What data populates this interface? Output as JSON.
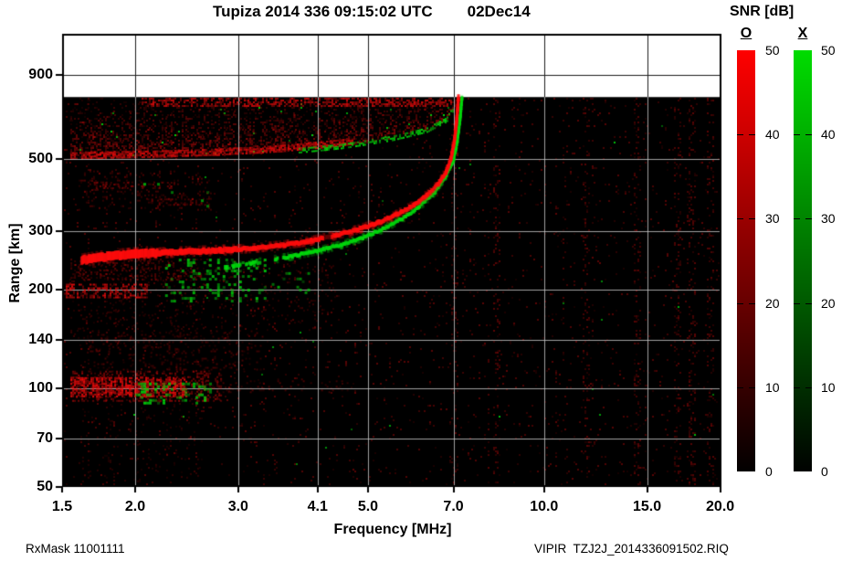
{
  "header": {
    "title": "Tupiza 2014 336 09:15:02 UTC",
    "date": "02Dec14"
  },
  "footer": {
    "rx_mask": "RxMask 11001111",
    "filename": "VIPIR  TZJ2J_2014336091502.RIQ"
  },
  "colorbar": {
    "title": "SNR [dB]",
    "range_db": [
      0,
      50
    ],
    "ticks": [
      {
        "label": "50",
        "value": 50
      },
      {
        "label": "40",
        "value": 40
      },
      {
        "label": "30",
        "value": 30
      },
      {
        "label": "20",
        "value": 20
      },
      {
        "label": "10",
        "value": 10
      },
      {
        "label": "0",
        "value": 0
      }
    ],
    "modes": [
      {
        "label": "O",
        "color": "#ff0000"
      },
      {
        "label": "X",
        "color": "#00dc00"
      }
    ]
  },
  "chart_data": {
    "type": "heatmap",
    "title": "Tupiza 2014 336 09:15:02 UTC 02Dec14",
    "xlabel": "Frequency [MHz]",
    "ylabel": "Range [km]",
    "x_scale": "log",
    "y_scale": "log",
    "xlim": [
      1.5,
      20.1
    ],
    "ylim": [
      50,
      1200
    ],
    "xticks": [
      1.5,
      2.0,
      3.0,
      4.1,
      5.0,
      7.0,
      10.0,
      15.0,
      20.0
    ],
    "xtick_labels": [
      "1.5",
      "2.0",
      "3.0",
      "4.1",
      "5.0",
      "7.0",
      "10.0",
      "15.0",
      "20.0"
    ],
    "yticks": [
      50,
      70,
      100,
      140,
      200,
      300,
      500,
      900
    ],
    "ytick_labels": [
      "50",
      "70",
      "100",
      "140",
      "200",
      "300",
      "500",
      "900"
    ],
    "snr_range_db": [
      0,
      50
    ],
    "no_data_above_km": 770,
    "foF2_MHz": 7.1,
    "fxF2_MHz": 7.25,
    "trace_notch_MHz": 4.27,
    "o_trace": [
      [
        1.62,
        245
      ],
      [
        1.8,
        252
      ],
      [
        2.0,
        256
      ],
      [
        2.4,
        260
      ],
      [
        2.8,
        263
      ],
      [
        3.2,
        267
      ],
      [
        3.6,
        273
      ],
      [
        4.0,
        281
      ],
      [
        4.4,
        292
      ],
      [
        4.8,
        304
      ],
      [
        5.2,
        319
      ],
      [
        5.6,
        338
      ],
      [
        6.0,
        362
      ],
      [
        6.3,
        387
      ],
      [
        6.6,
        420
      ],
      [
        6.8,
        455
      ],
      [
        6.93,
        500
      ],
      [
        7.02,
        560
      ],
      [
        7.08,
        640
      ],
      [
        7.12,
        720
      ],
      [
        7.14,
        770
      ]
    ],
    "x_trace": [
      [
        2.85,
        233
      ],
      [
        3.3,
        243
      ],
      [
        3.7,
        252
      ],
      [
        4.1,
        262
      ],
      [
        4.5,
        273
      ],
      [
        4.9,
        287
      ],
      [
        5.3,
        305
      ],
      [
        5.7,
        327
      ],
      [
        6.1,
        355
      ],
      [
        6.5,
        395
      ],
      [
        6.8,
        445
      ],
      [
        7.0,
        495
      ],
      [
        7.1,
        560
      ],
      [
        7.18,
        655
      ],
      [
        7.24,
        770
      ]
    ],
    "spread_band": {
      "f": [
        1.55,
        7.08
      ],
      "km_top": 770,
      "km_bottom_points": [
        [
          1.55,
          500
        ],
        [
          2.5,
          510
        ],
        [
          3.5,
          525
        ],
        [
          4.5,
          548
        ],
        [
          5.5,
          580
        ],
        [
          6.3,
          615
        ],
        [
          6.8,
          660
        ],
        [
          7.0,
          720
        ],
        [
          7.1,
          770
        ]
      ],
      "bright_top_f": [
        2.05,
        7.0
      ],
      "bright_bottom_f": [
        1.55,
        4.7
      ],
      "green_edge_f": [
        3.8,
        7.0
      ]
    },
    "regions": [
      {
        "name": "e-region-top-diffuse",
        "mode": "O",
        "f": [
          1.65,
          3.3
        ],
        "km": [
          112,
          150
        ],
        "density": 0.2,
        "alpha": 0.3,
        "front": false
      },
      {
        "name": "e-region-tail",
        "mode": "O",
        "f": [
          2.8,
          4.6
        ],
        "km": [
          97,
          107
        ],
        "density": 0.2,
        "alpha": 0.3,
        "front": false
      },
      {
        "name": "valley-scatter",
        "mode": "O",
        "f": [
          1.6,
          4.4
        ],
        "km": [
          150,
          240
        ],
        "density": 0.1,
        "alpha": 0.25,
        "front": false
      },
      {
        "name": "below-200-diffuse",
        "mode": "O",
        "f": [
          1.55,
          2.6
        ],
        "km": [
          128,
          185
        ],
        "density": 0.1,
        "alpha": 0.22,
        "front": false
      },
      {
        "name": "mid-scatter",
        "mode": "O",
        "f": [
          1.6,
          2.7
        ],
        "km": [
          350,
          460
        ],
        "density": 0.22,
        "alpha": 0.3,
        "front": false
      },
      {
        "name": "mid-streak-1",
        "mode": "O",
        "f": [
          1.7,
          2.3
        ],
        "km": [
          405,
          425
        ],
        "density": 0.5,
        "alpha": 0.4,
        "front": false
      },
      {
        "name": "mid-streak-2",
        "mode": "O",
        "f": [
          2.1,
          2.65
        ],
        "km": [
          360,
          378
        ],
        "density": 0.5,
        "alpha": 0.4,
        "front": false
      },
      {
        "name": "sub-e-columns",
        "mode": "O",
        "f": [
          1.6,
          2.6
        ],
        "km": [
          52,
          92
        ],
        "density": 0.08,
        "alpha": 0.2,
        "front": false
      },
      {
        "name": "trace-underglow",
        "mode": "O",
        "f": [
          1.55,
          2.6
        ],
        "km": [
          215,
          248
        ],
        "density": 0.45,
        "alpha": 0.35,
        "front": false
      },
      {
        "name": "e-region-wide",
        "mode": "O",
        "f": [
          1.55,
          2.8
        ],
        "km": [
          92,
          113
        ],
        "density": 0.5,
        "alpha": 0.55,
        "front": true
      },
      {
        "name": "e-region-core",
        "mode": "O",
        "f": [
          1.55,
          2.45
        ],
        "km": [
          95,
          108
        ],
        "density": 0.9,
        "alpha": 0.95,
        "front": true
      },
      {
        "name": "200km-band",
        "mode": "O",
        "f": [
          1.5,
          2.1
        ],
        "km": [
          188,
          208
        ],
        "density": 0.85,
        "alpha": 0.85,
        "front": true
      },
      {
        "name": "e-region-x-patches",
        "mode": "X",
        "f": [
          2.0,
          2.7
        ],
        "km": [
          90,
          104
        ],
        "density": 0.45,
        "alpha": 0.9,
        "front": true
      },
      {
        "name": "valley-x-clusters",
        "mode": "X",
        "f": [
          2.25,
          3.35
        ],
        "km": [
          183,
          248
        ],
        "density": 0.3,
        "alpha": 0.85,
        "front": true
      },
      {
        "name": "valley-x-clusters-2",
        "mode": "X",
        "f": [
          3.35,
          3.95
        ],
        "km": [
          195,
          230
        ],
        "density": 0.12,
        "alpha": 0.75,
        "front": true
      },
      {
        "name": "mid-x-specks",
        "mode": "X",
        "f": [
          2.0,
          2.7
        ],
        "km": [
          345,
          430
        ],
        "density": 0.05,
        "alpha": 0.8,
        "front": true
      }
    ],
    "noise_columns_MHz": [
      7.03,
      8.3,
      11.8,
      14.4,
      16.9,
      17.8,
      19.2
    ],
    "colors": {
      "o_mode": "#ff0a0a",
      "x_mode": "#00d80a",
      "grid_on_data": "#c8c8c8",
      "grid_on_white": "#1d1d1d",
      "background": "#000000",
      "no_data": "#ffffff"
    }
  }
}
